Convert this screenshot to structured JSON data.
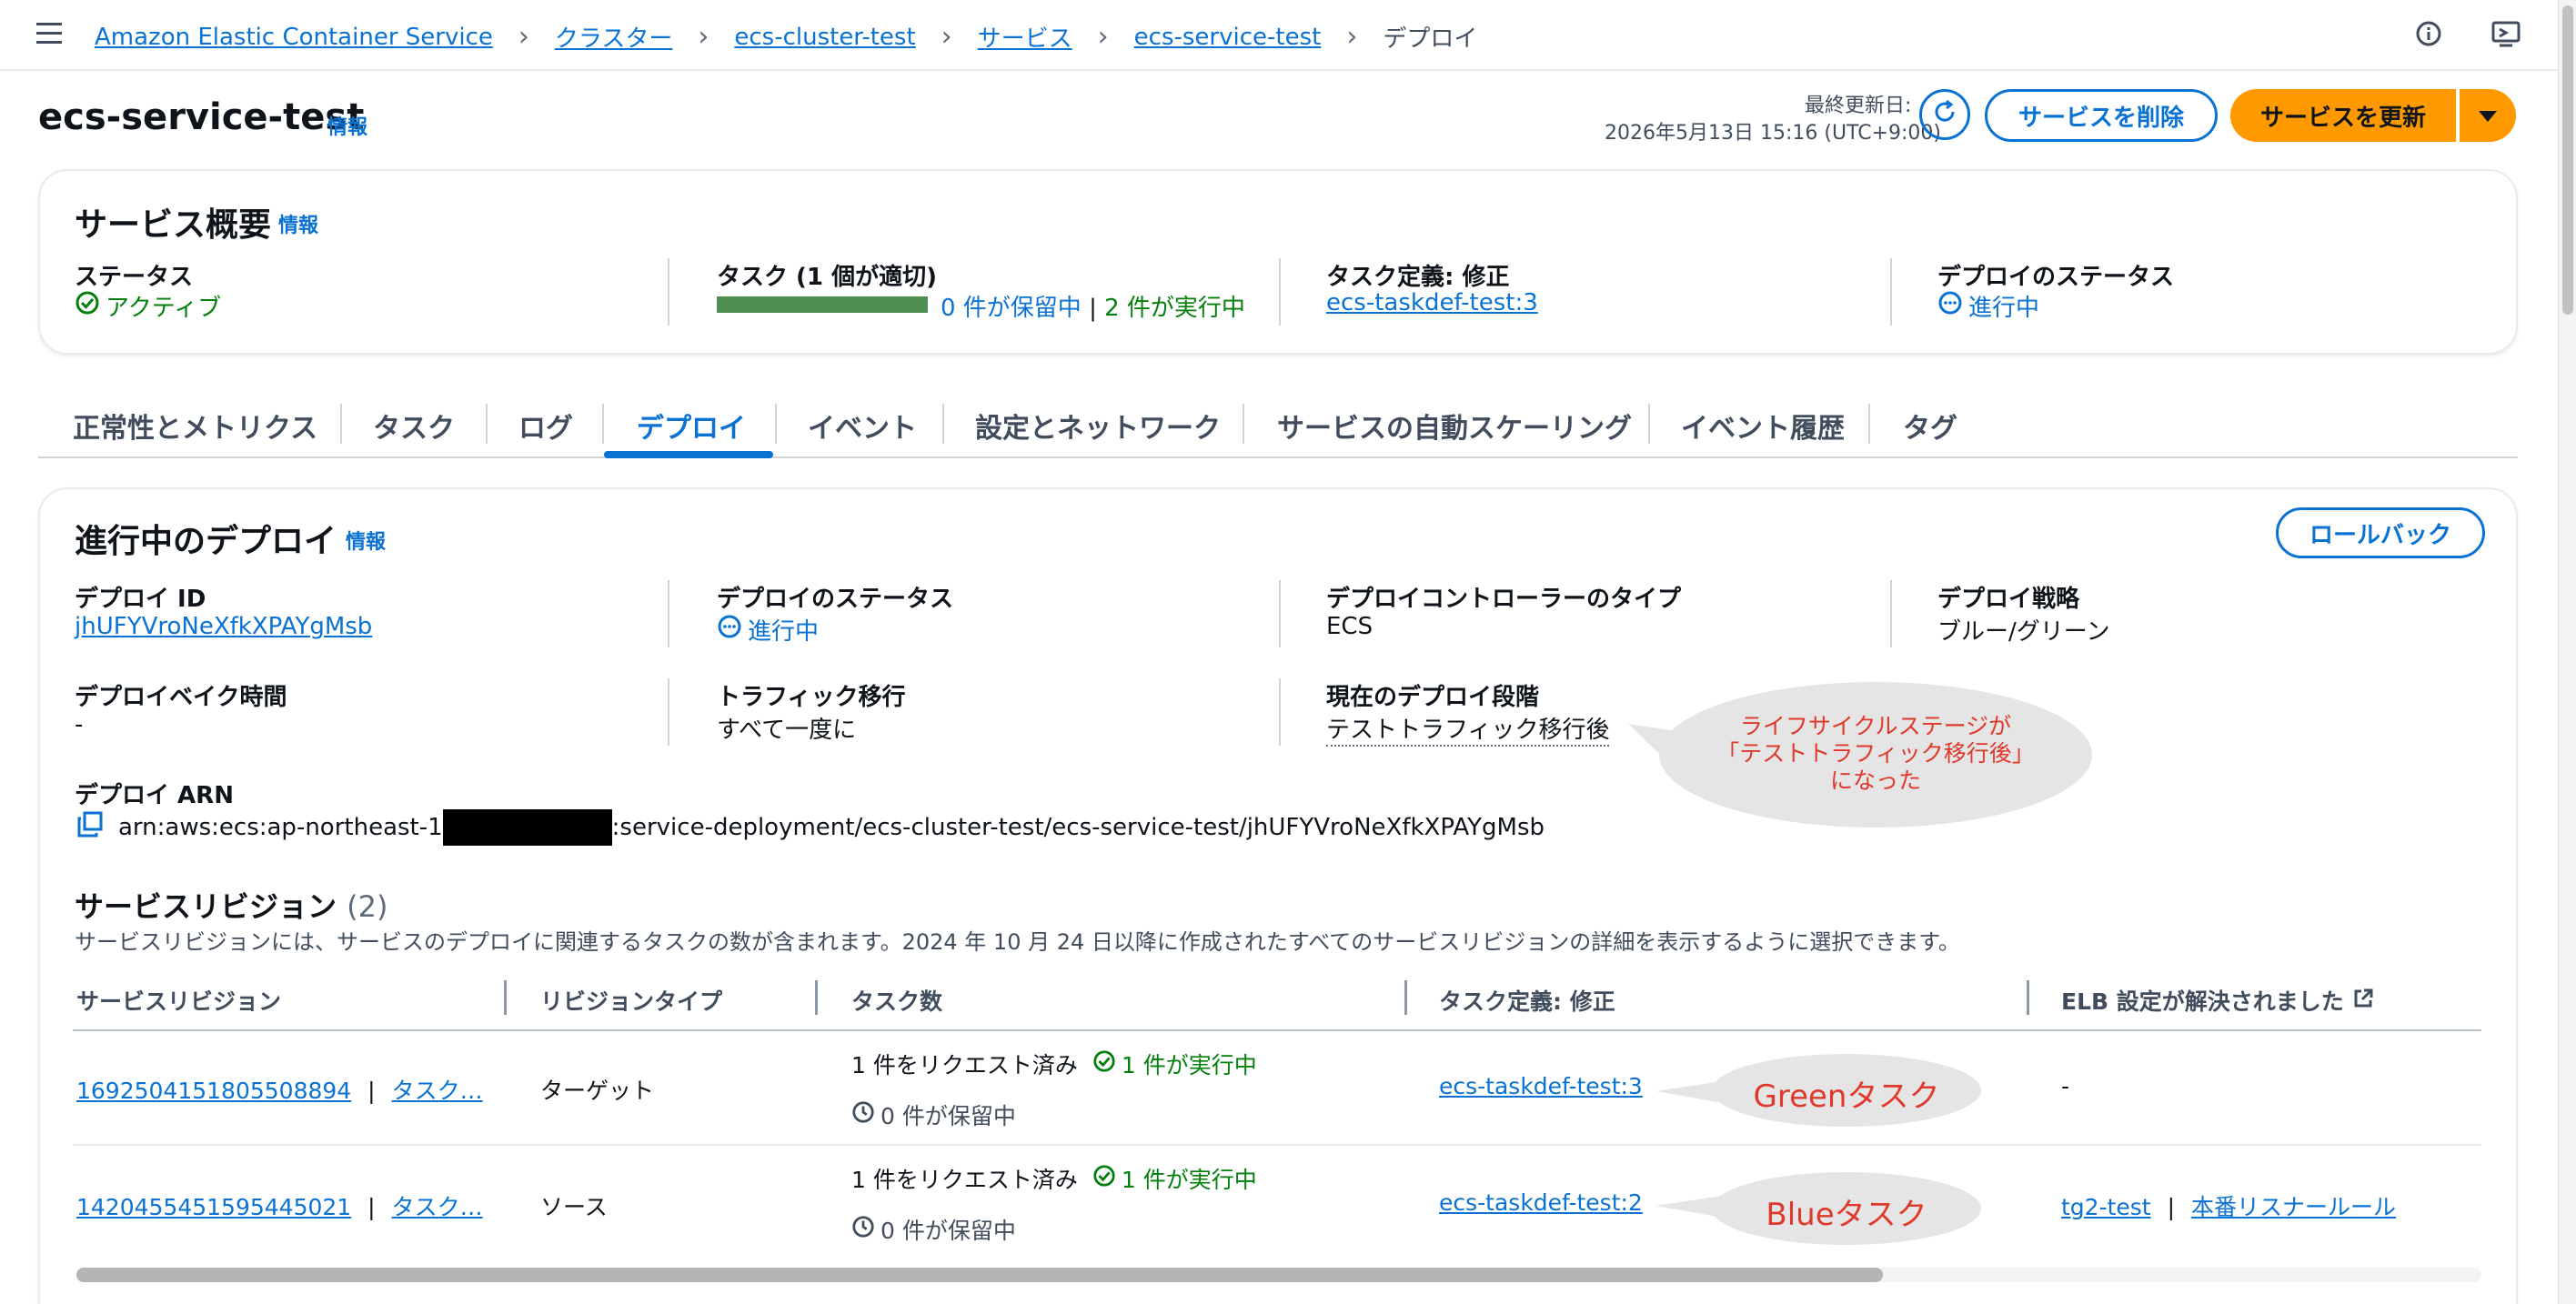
{
  "breadcrumb": {
    "items": [
      "Amazon Elastic Container Service",
      "クラスター",
      "ecs-cluster-test",
      "サービス",
      "ecs-service-test"
    ],
    "current": "デプロイ"
  },
  "header": {
    "title": "ecs-service-test",
    "info": "情報",
    "last_updated_label": "最終更新日:",
    "last_updated_value": "2026年5月13日 15:16 (UTC+9:00)",
    "delete_button": "サービスを削除",
    "update_button": "サービスを更新"
  },
  "overview": {
    "title": "サービス概要",
    "info": "情報",
    "status_label": "ステータス",
    "status_value": "アクティブ",
    "tasks_label": "タスク (1 個が適切)",
    "tasks_pending": "0 件が保留中",
    "tasks_sep": "|",
    "tasks_running": "2 件が実行中",
    "tasks_progress": 1.0,
    "taskdef_label": "タスク定義: 修正",
    "taskdef_value": "ecs-taskdef-test:3",
    "deploy_status_label": "デプロイのステータス",
    "deploy_status_value": "進行中"
  },
  "tabs": [
    {
      "label": "正常性とメトリクス",
      "active": false
    },
    {
      "label": "タスク",
      "active": false
    },
    {
      "label": "ログ",
      "active": false
    },
    {
      "label": "デプロイ",
      "active": true
    },
    {
      "label": "イベント",
      "active": false
    },
    {
      "label": "設定とネットワーク",
      "active": false
    },
    {
      "label": "サービスの自動スケーリング",
      "active": false
    },
    {
      "label": "イベント履歴",
      "active": false
    },
    {
      "label": "タグ",
      "active": false
    }
  ],
  "deploy": {
    "title": "進行中のデプロイ",
    "info": "情報",
    "rollback_button": "ロールバック",
    "id_label": "デプロイ ID",
    "id_value": "jhUFYVroNeXfkXPAYgMsb",
    "status_label": "デプロイのステータス",
    "status_value": "進行中",
    "controller_label": "デプロイコントローラーのタイプ",
    "controller_value": "ECS",
    "strategy_label": "デプロイ戦略",
    "strategy_value": "ブルー/グリーン",
    "bake_label": "デプロイベイク時間",
    "bake_value": "-",
    "traffic_label": "トラフィック移行",
    "traffic_value": "すべて一度に",
    "phase_label": "現在のデプロイ段階",
    "phase_value": "テストトラフィック移行後",
    "arn_label": "デプロイ ARN",
    "arn_prefix": "arn:aws:ecs:ap-northeast-1",
    "arn_suffix": ":service-deployment/ecs-cluster-test/ecs-service-test/jhUFYVroNeXfkXPAYgMsb"
  },
  "revisions": {
    "title": "サービスリビジョン",
    "count": "(2)",
    "description": "サービスリビジョンには、サービスのデプロイに関連するタスクの数が含まれます。2024 年 10 月 24 日以降に作成されたすべてのサービスリビジョンの詳細を表示するように選択できます。",
    "columns": [
      "サービスリビジョン",
      "リビジョンタイプ",
      "タスク数",
      "タスク定義: 修正",
      "ELB 設定が解決されました"
    ],
    "rows": [
      {
        "revision": "1692504151805508894",
        "sep": "|",
        "tasks_link": "タスク…",
        "type": "ターゲット",
        "requested": "1 件をリクエスト済み",
        "running": "1 件が実行中",
        "pending": "0 件が保留中",
        "taskdef": "ecs-taskdef-test:3",
        "elb": "-"
      },
      {
        "revision": "1420455451595445021",
        "sep": "|",
        "tasks_link": "タスク…",
        "type": "ソース",
        "requested": "1 件をリクエスト済み",
        "running": "1 件が実行中",
        "pending": "0 件が保留中",
        "taskdef": "ecs-taskdef-test:2",
        "elb_tg": "tg2-test",
        "elb_sep": "|",
        "elb_rule": "本番リスナールール"
      }
    ]
  },
  "annotations": {
    "phase_note_line1": "ライフサイクルステージが",
    "phase_note_line2": "「テストトラフィック移行後」",
    "phase_note_line3": "になった",
    "green_note": "Greenタスク",
    "blue_note": "Blueタスク"
  },
  "colors": {
    "link": "#0972d3",
    "success": "#037f0c",
    "primary_button": "#ff9900",
    "annotation_text": "#e0392b",
    "annotation_bubble": "#e5e5e5"
  }
}
